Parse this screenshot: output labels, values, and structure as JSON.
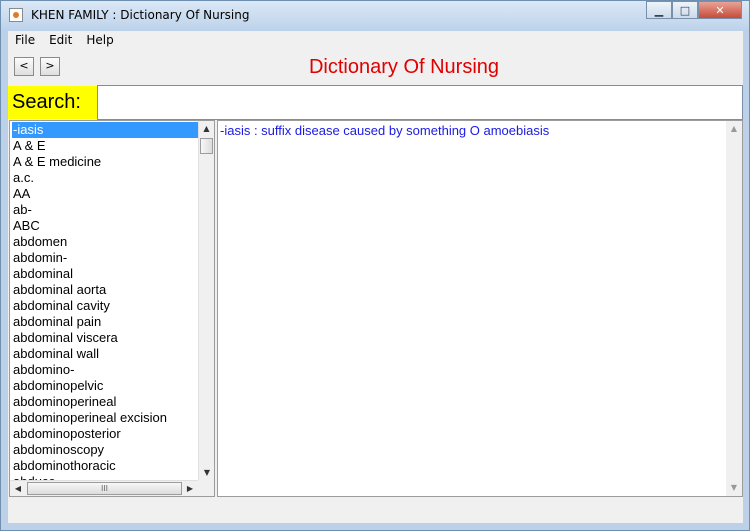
{
  "window": {
    "title": "KHEN FAMILY : Dictionary Of Nursing",
    "controls": {
      "minimize": "▁",
      "maximize": "□",
      "close": "✕"
    }
  },
  "menu": {
    "file": "File",
    "edit": "Edit",
    "help": "Help"
  },
  "nav": {
    "back": "<",
    "forward": ">"
  },
  "header": {
    "title": "Dictionary Of Nursing",
    "title_color": "#e00000"
  },
  "search": {
    "label": "Search:",
    "value": "",
    "label_bg": "#ffff00"
  },
  "terms": [
    "-iasis",
    "A & E",
    "A & E medicine",
    "a.c.",
    "AA",
    "ab-",
    "ABC",
    "abdomen",
    "abdomin-",
    "abdominal",
    "abdominal aorta",
    "abdominal cavity",
    "abdominal pain",
    "abdominal viscera",
    "abdominal wall",
    "abdomino-",
    "abdominopelvic",
    "abdominoperineal",
    "abdominoperineal excision",
    "abdominoposterior",
    "abdominoscopy",
    "abdominothoracic",
    "abduce"
  ],
  "selected_term_index": 0,
  "definition": {
    "text": "-iasis : suffix disease caused by something O amoebiasis",
    "color": "#1a1ae6"
  },
  "scroll_glyphs": {
    "up": "▲",
    "down": "▼",
    "left": "◀",
    "right": "▶",
    "grip": "III"
  }
}
